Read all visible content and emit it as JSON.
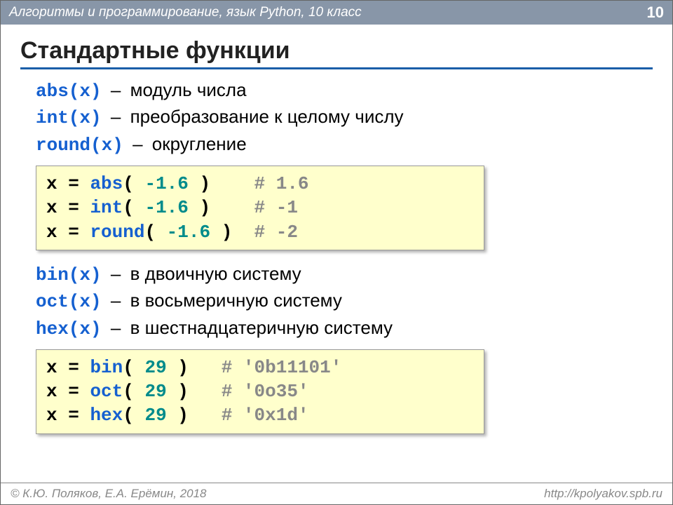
{
  "header": {
    "title": "Алгоритмы и программирование, язык Python, 10 класс",
    "page": "10"
  },
  "title": "Стандартные функции",
  "defs1": [
    {
      "fn": "abs(x)",
      "desc": "модуль числа"
    },
    {
      "fn": "int(x)",
      "desc": "преобразование к целому числу"
    },
    {
      "fn": "round(x)",
      "desc": "округление"
    }
  ],
  "code1": [
    {
      "lhs": "x",
      "eq": "=",
      "fn": "abs",
      "op": "(",
      "arg": " -1.6 ",
      "cp": ")",
      "pad": "    ",
      "cmt": "# 1.6"
    },
    {
      "lhs": "x",
      "eq": "=",
      "fn": "int",
      "op": "(",
      "arg": " -1.6 ",
      "cp": ")",
      "pad": "    ",
      "cmt": "# -1"
    },
    {
      "lhs": "x",
      "eq": "=",
      "fn": "round",
      "op": "(",
      "arg": " -1.6 ",
      "cp": ")",
      "pad": "  ",
      "cmt": "# -2"
    }
  ],
  "defs2": [
    {
      "fn": "bin(x)",
      "desc": "в двоичную систему"
    },
    {
      "fn": "oct(x)",
      "desc": "в восьмеричную систему"
    },
    {
      "fn": "hex(x)",
      "desc": "в шестнадцатеричную систему"
    }
  ],
  "code2": [
    {
      "lhs": "x",
      "eq": "=",
      "fn": "bin",
      "op": "(",
      "arg": " 29 ",
      "cp": ")",
      "pad": "   ",
      "cmt": "# '0b11101'"
    },
    {
      "lhs": "x",
      "eq": "=",
      "fn": "oct",
      "op": "(",
      "arg": " 29 ",
      "cp": ")",
      "pad": "   ",
      "cmt": "# '0o35'"
    },
    {
      "lhs": "x",
      "eq": "=",
      "fn": "hex",
      "op": "(",
      "arg": " 29 ",
      "cp": ")",
      "pad": "   ",
      "cmt": "# '0x1d'"
    }
  ],
  "footer": {
    "left": "© К.Ю. Поляков, Е.А. Ерёмин, 2018",
    "right": "http://kpolyakov.spb.ru"
  }
}
